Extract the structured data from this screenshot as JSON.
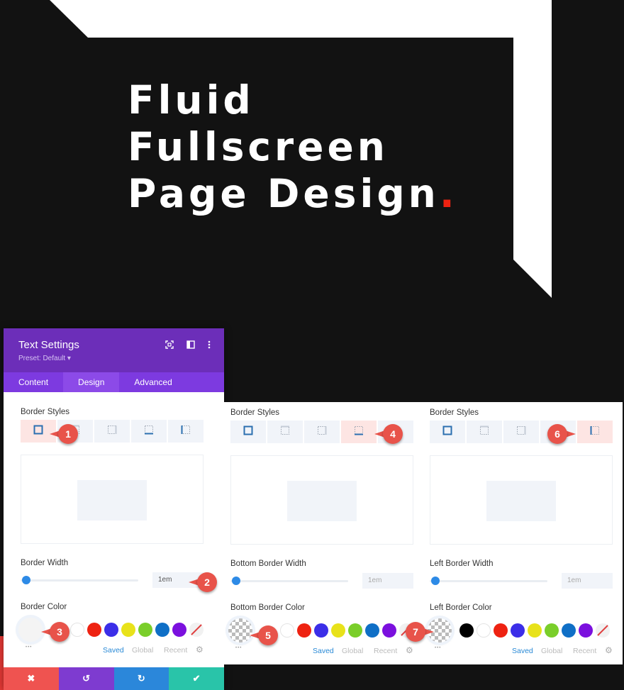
{
  "hero": {
    "title_lines": [
      "Fluid",
      "Fullscreen",
      "Page Design"
    ],
    "title_dot": ".",
    "accent_color": "#ee2211"
  },
  "settings_panel": {
    "title": "Text Settings",
    "preset": "Preset: Default ▾",
    "header_icons": [
      "fullscreen-icon",
      "sidebar-layout-icon",
      "more-vertical-icon"
    ],
    "tabs": [
      {
        "label": "Content",
        "active": false
      },
      {
        "label": "Design",
        "active": true
      },
      {
        "label": "Advanced",
        "active": false
      }
    ],
    "footer_buttons": [
      {
        "name": "cancel",
        "icon": "✖",
        "color": "#ef5350"
      },
      {
        "name": "undo",
        "icon": "↺",
        "color": "#7e3bd0"
      },
      {
        "name": "redo",
        "icon": "↻",
        "color": "#2b87da"
      },
      {
        "name": "save",
        "icon": "✔",
        "color": "#29c4a9"
      }
    ]
  },
  "panels": [
    {
      "border_styles_label": "Border Styles",
      "style_options": [
        "all",
        "top",
        "right",
        "bottom",
        "left"
      ],
      "selected_style": "all",
      "width_label": "Border Width",
      "width_value": "1em",
      "width_slider_fraction": 0.0,
      "color_label": "Border Color",
      "picker_state": "blank",
      "swatches": [
        "#ffffff",
        "#ee2211",
        "#3b2ee8",
        "#e8e21a",
        "#7ace2a",
        "#0f6fc6",
        "#7b10de",
        "none"
      ],
      "palette_tabs": [
        "Saved",
        "Global",
        "Recent"
      ],
      "active_palette_tab": "Saved",
      "callouts": [
        {
          "num": "1"
        },
        {
          "num": "2"
        },
        {
          "num": "3"
        }
      ]
    },
    {
      "border_styles_label": "Border Styles",
      "style_options": [
        "all",
        "top",
        "right",
        "bottom",
        "left"
      ],
      "selected_style": "bottom",
      "width_label": "Bottom Border Width",
      "width_value": "1em",
      "width_slider_fraction": 0.0,
      "color_label": "Bottom Border Color",
      "picker_state": "transparent",
      "swatches": [
        "#ffffff",
        "#ee2211",
        "#3b2ee8",
        "#e8e21a",
        "#7ace2a",
        "#0f6fc6",
        "#7b10de",
        "none"
      ],
      "palette_tabs": [
        "Saved",
        "Global",
        "Recent"
      ],
      "active_palette_tab": "Saved",
      "callouts": [
        {
          "num": "4"
        },
        {
          "num": "5"
        },
        {
          "num": "7"
        }
      ]
    },
    {
      "border_styles_label": "Border Styles",
      "style_options": [
        "all",
        "top",
        "right",
        "bottom",
        "left"
      ],
      "selected_style": "left",
      "width_label": "Left Border Width",
      "width_value": "1em",
      "width_slider_fraction": 0.0,
      "color_label": "Left Border Color",
      "picker_state": "transparent",
      "swatches": [
        "#000000",
        "#ffffff",
        "#ee2211",
        "#3b2ee8",
        "#e8e21a",
        "#7ace2a",
        "#0f6fc6",
        "#7b10de",
        "none"
      ],
      "palette_tabs": [
        "Saved",
        "Global",
        "Recent"
      ],
      "active_palette_tab": "Saved",
      "callouts": [
        {
          "num": "6"
        }
      ]
    }
  ]
}
